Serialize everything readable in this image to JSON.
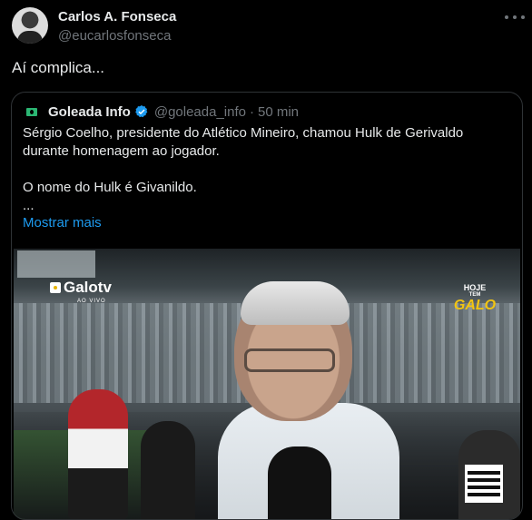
{
  "author": {
    "name": "Carlos A. Fonseca",
    "handle": "@eucarlosfonseca"
  },
  "tweet_text": "Aí complica...",
  "quote": {
    "name": "Goleada Info",
    "handle": "@goleada_info",
    "separator": "·",
    "time": "50 min",
    "line1": "Sérgio Coelho, presidente do Atlético Mineiro, chamou Hulk de Gerivaldo",
    "line2": "durante homenagem ao jogador.",
    "line3": "O nome do Hulk é Givanildo.",
    "line4": "...",
    "show_more": "Mostrar mais"
  },
  "media": {
    "brand": "Galotv",
    "live": "AO VIVO",
    "badge_top": "HOJE",
    "badge_small": "TEM",
    "badge_big": "GALO"
  },
  "colors": {
    "background": "#000000",
    "link": "#1d9bf0",
    "verified": "#1d9bf0",
    "secondary_text": "#71767b"
  }
}
